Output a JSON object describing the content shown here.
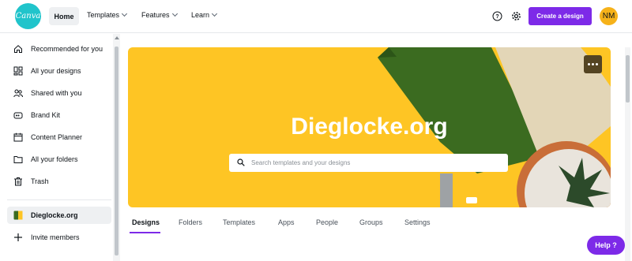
{
  "app": {
    "logo_text": "Canva"
  },
  "nav": {
    "home": "Home",
    "items": [
      {
        "label": "Templates"
      },
      {
        "label": "Features"
      },
      {
        "label": "Learn"
      }
    ],
    "create_label": "Create a design",
    "avatar_initials": "NM"
  },
  "sidebar": {
    "items": [
      {
        "label": "Recommended for you",
        "icon": "home-icon"
      },
      {
        "label": "All your designs",
        "icon": "grid-icon"
      },
      {
        "label": "Shared with you",
        "icon": "people-icon"
      },
      {
        "label": "Brand Kit",
        "icon": "brand-kit-icon"
      },
      {
        "label": "Content Planner",
        "icon": "calendar-icon"
      },
      {
        "label": "All your folders",
        "icon": "folder-icon"
      },
      {
        "label": "Trash",
        "icon": "trash-icon"
      }
    ],
    "team": {
      "label": "Dieglocke.org",
      "icon": "team-avatar-icon"
    },
    "invite": {
      "label": "Invite members",
      "icon": "plus-icon"
    }
  },
  "banner": {
    "title": "Dieglocke.org",
    "search_placeholder": "Search templates and your designs",
    "colors": {
      "background": "#fec524",
      "book_green": "#3b6b20"
    }
  },
  "tabs": [
    {
      "label": "Designs",
      "active": true
    },
    {
      "label": "Folders"
    },
    {
      "label": "Templates"
    },
    {
      "label": "Apps"
    },
    {
      "label": "People"
    },
    {
      "label": "Groups"
    },
    {
      "label": "Settings"
    }
  ],
  "help": {
    "label": "Help ?"
  },
  "theme": {
    "accent": "#7d2ae8",
    "logo": "#20c4cb"
  }
}
